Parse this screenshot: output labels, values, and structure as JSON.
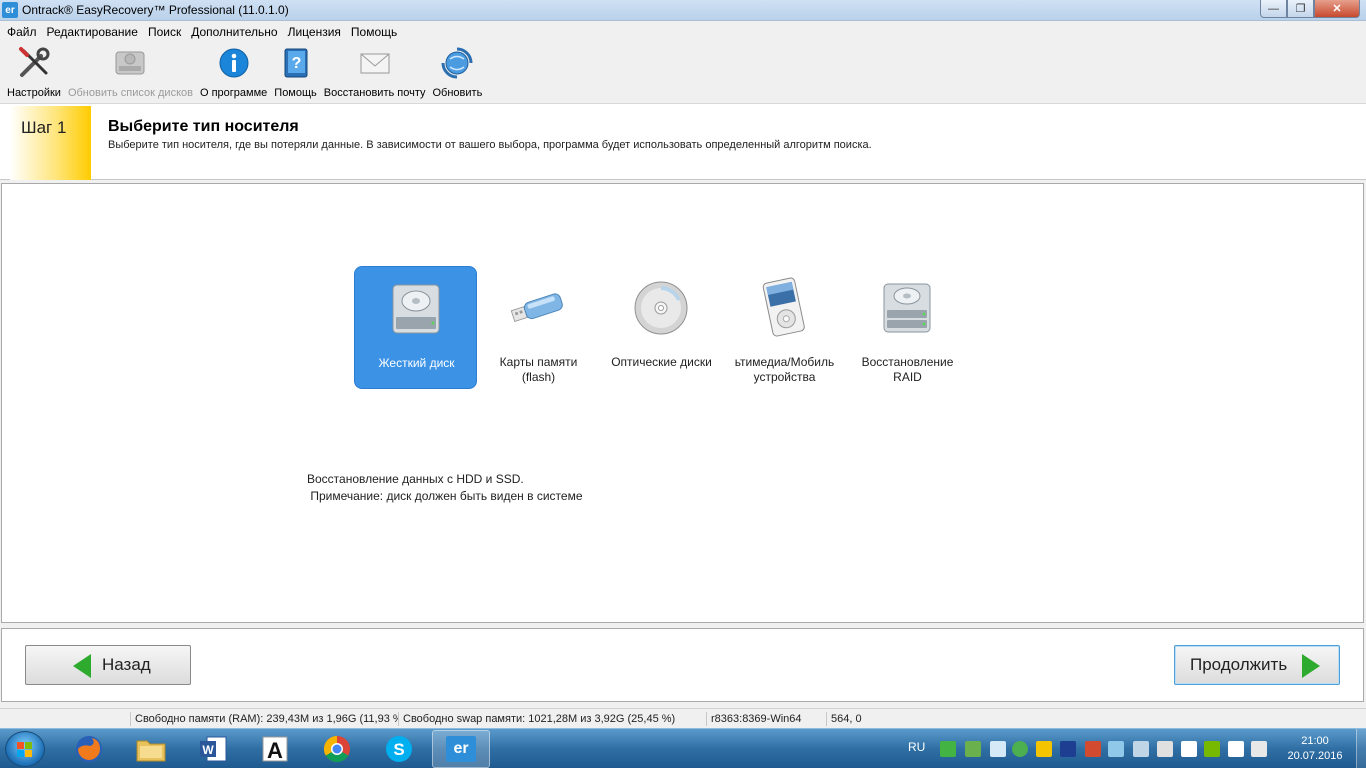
{
  "window": {
    "app_icon_text": "er",
    "title": "Ontrack® EasyRecovery™ Professional (11.0.1.0)",
    "controls": {
      "minimize": "—",
      "maximize": "❐",
      "close": "✕"
    }
  },
  "menu": {
    "items": [
      "Файл",
      "Редактирование",
      "Поиск",
      "Дополнительно",
      "Лицензия",
      "Помощь"
    ]
  },
  "toolbar": {
    "items": [
      {
        "label": "Настройки",
        "icon": "tools-icon",
        "enabled": true
      },
      {
        "label": "Обновить список дисков",
        "icon": "refresh-drives-icon",
        "enabled": false
      },
      {
        "label": "О программе",
        "icon": "info-icon",
        "enabled": true
      },
      {
        "label": "Помощь",
        "icon": "help-book-icon",
        "enabled": true
      },
      {
        "label": "Восстановить почту",
        "icon": "envelope-icon",
        "enabled": true
      },
      {
        "label": "Обновить",
        "icon": "update-globe-icon",
        "enabled": true
      }
    ]
  },
  "step": {
    "badge": "Шаг 1",
    "title": "Выберите тип носителя",
    "description": "Выберите тип носителя, где вы потеряли данные. В зависимости от вашего выбора, программа будет использовать определенный алгоритм поиска."
  },
  "media": {
    "selected_index": 0,
    "options": [
      {
        "label_line1": "Жесткий диск",
        "label_line2": "",
        "icon": "hard-disk-icon"
      },
      {
        "label_line1": "Карты памяти",
        "label_line2": "(flash)",
        "icon": "usb-flash-icon"
      },
      {
        "label_line1": "Оптические диски",
        "label_line2": "",
        "icon": "optical-disc-icon"
      },
      {
        "label_line1": "ьтимедиа/Мобиль",
        "label_line2": "устройства",
        "icon": "media-player-icon"
      },
      {
        "label_line1": "Восстановление",
        "label_line2": "RAID",
        "icon": "raid-disk-icon"
      }
    ],
    "description_line1": "Восстановление данных с HDD и SSD.",
    "description_line2": " Примечание: диск должен быть виден в системе"
  },
  "nav": {
    "back_label": "Назад",
    "next_label": "Продолжить"
  },
  "status": {
    "ram": "Свободно памяти (RAM): 239,43M из 1,96G (11,93 %)",
    "swap": "Свободно swap памяти: 1021,28M из 3,92G (25,45 %)",
    "build": "r8363:8369-Win64",
    "coords": "564, 0"
  },
  "taskbar": {
    "items": [
      "firefox-icon",
      "explorer-folder-icon",
      "word-icon",
      "font-a-icon",
      "chrome-icon",
      "skype-icon",
      "easyrecovery-icon"
    ],
    "active_index": 6,
    "er_label": "er",
    "lang": "RU",
    "time": "21:00",
    "date": "20.07.2016"
  },
  "colors": {
    "selected_media": "#3c93e6",
    "step_badge": "#ffcc00",
    "arrow_green": "#2eaa2e"
  }
}
